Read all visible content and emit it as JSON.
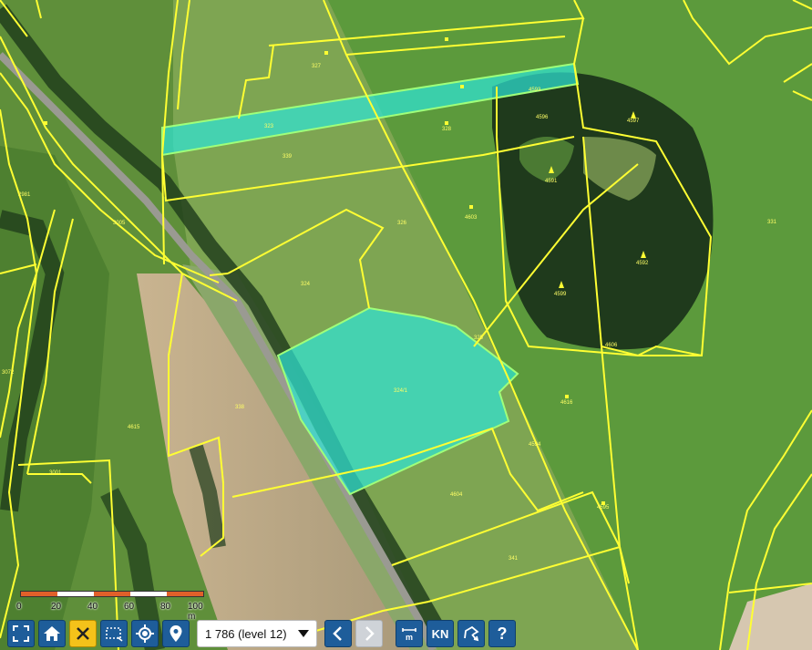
{
  "map": {
    "parcel_labels": [
      "327",
      "323",
      "4593",
      "4596",
      "4597",
      "328",
      "339",
      "326",
      "2981",
      "324",
      "4591",
      "3005",
      "4603",
      "4592",
      "4599",
      "331",
      "325",
      "4606",
      "4616",
      "324/1",
      "338",
      "3072",
      "4615",
      "4594",
      "4604",
      "3001",
      "4595",
      "341"
    ]
  },
  "scale": {
    "labels": [
      "0",
      "20",
      "40",
      "60",
      "80",
      "100 m"
    ]
  },
  "toolbar": {
    "zoom_value": "1 786 (level 12)",
    "kn_label": "KN",
    "help_label": "?"
  },
  "colors": {
    "parcel_border": "#ffff33",
    "selection_fill": "#2ee6d8",
    "button_blue": "#1e5d9a",
    "button_yellow": "#f4c21a"
  }
}
